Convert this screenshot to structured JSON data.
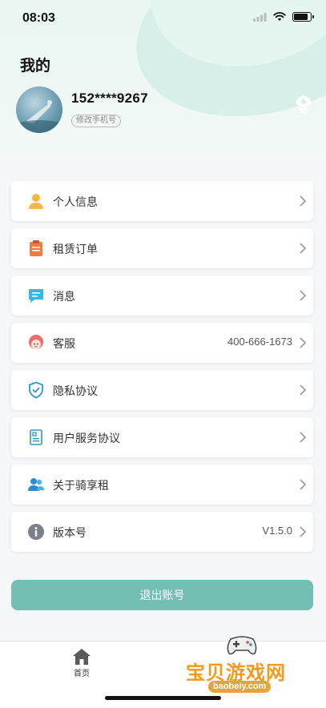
{
  "status_bar": {
    "time": "08:03"
  },
  "header": {
    "title": "我的",
    "phone": "152****9267",
    "edit_phone_label": "修改手机号"
  },
  "menu": {
    "items": [
      {
        "label": "个人信息",
        "icon": "user-icon",
        "value": ""
      },
      {
        "label": "租赁订单",
        "icon": "clipboard-icon",
        "value": ""
      },
      {
        "label": "消息",
        "icon": "message-icon",
        "value": ""
      },
      {
        "label": "客服",
        "icon": "customer-service-icon",
        "value": "400-666-1673"
      },
      {
        "label": "隐私协议",
        "icon": "shield-icon",
        "value": ""
      },
      {
        "label": "用户服务协议",
        "icon": "document-icon",
        "value": ""
      },
      {
        "label": "关于骑享租",
        "icon": "users-icon",
        "value": ""
      },
      {
        "label": "版本号",
        "icon": "info-icon",
        "value": "V1.5.0"
      }
    ]
  },
  "logout_label": "退出账号",
  "tabbar": {
    "home_label": "首页"
  },
  "watermark": {
    "text": "宝贝游戏网",
    "url": "baobeiy.com"
  },
  "colors": {
    "accent": "#74bfb4",
    "header_bg": "#e9f6f2"
  }
}
